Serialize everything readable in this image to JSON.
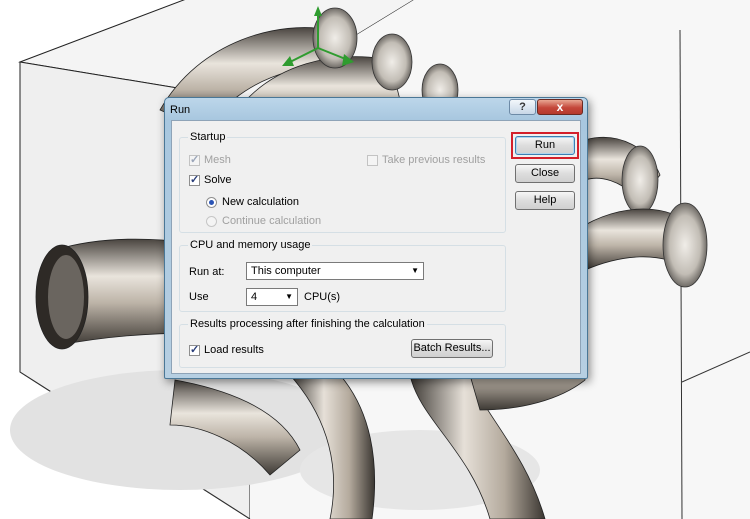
{
  "dialog": {
    "title": "Run",
    "help_glyph": "?",
    "close_glyph": "x"
  },
  "startup": {
    "label": "Startup",
    "mesh": "Mesh",
    "take_previous": "Take previous results",
    "solve": "Solve",
    "new_calc": "New calculation",
    "continue_calc": "Continue calculation"
  },
  "cpu": {
    "label": "CPU and memory usage",
    "run_at_label": "Run at:",
    "run_at_value": "This computer",
    "use_label": "Use",
    "use_value": "4",
    "cpu_unit": "CPU(s)"
  },
  "results": {
    "label": "Results processing after finishing the calculation",
    "load": "Load results",
    "batch_button": "Batch Results..."
  },
  "buttons": {
    "run": "Run",
    "close": "Close",
    "help": "Help"
  },
  "colors": {
    "highlight": "#d31f2a",
    "title_bar": "#a8c7df",
    "dialog_bg": "#f0f0f0"
  }
}
